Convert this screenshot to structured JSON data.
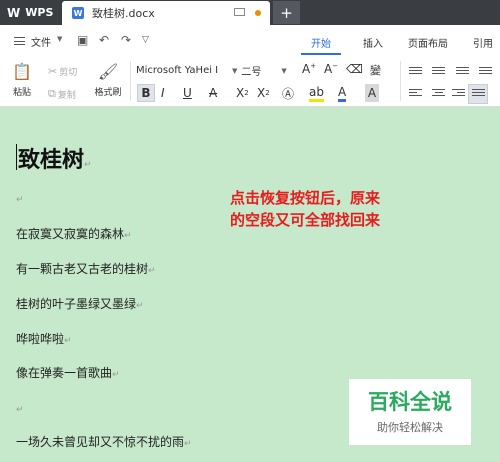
{
  "titlebar": {
    "app_name": "WPS",
    "doc_tab_title": "致桂树.docx",
    "new_tab_label": "+"
  },
  "menubar": {
    "file_label": "文件",
    "tabs": [
      {
        "label": "开始",
        "active": true
      },
      {
        "label": "插入",
        "active": false
      },
      {
        "label": "页面布局",
        "active": false
      },
      {
        "label": "引用",
        "active": false
      }
    ]
  },
  "toolbar": {
    "paste_label": "粘贴",
    "cut_label": "剪切",
    "copy_label": "复制",
    "format_painter_label": "格式刷",
    "font_name": "Microsoft YaHei I",
    "font_size": "二号",
    "clear_format_symbol": "⌫",
    "pinyin_label": "變"
  },
  "document": {
    "title": "致桂树",
    "paragraphs": [
      "在寂寞又寂寞的森林",
      "有一颗古老又古老的桂树",
      "桂树的叶子墨绿又墨绿",
      "哗啦哗啦",
      "像在弹奏一首歌曲",
      "一场久未曾见却又不惊不扰的雨"
    ],
    "para_end_mark": "↵"
  },
  "annotation": {
    "line1": "点击恢复按钮后，原来",
    "line2": "的空段又可全部找回来"
  },
  "watermark": {
    "title": "百科全说",
    "subtitle": "助你轻松解决"
  },
  "colors": {
    "accent": "#2f6fd6",
    "doc_background": "#c6e8cb",
    "annotation": "#e81c1c",
    "watermark_green": "#2aaa5e"
  }
}
